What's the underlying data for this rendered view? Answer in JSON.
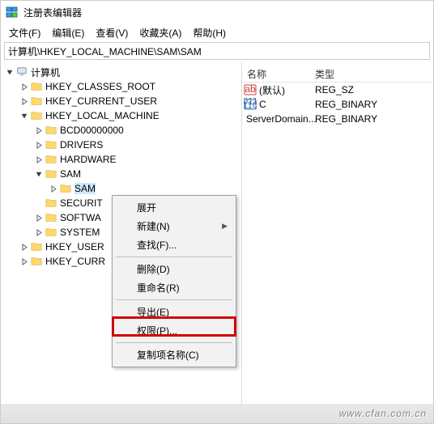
{
  "titlebar": {
    "title": "注册表编辑器"
  },
  "menubar": [
    {
      "label": "文件(F)"
    },
    {
      "label": "编辑(E)"
    },
    {
      "label": "查看(V)"
    },
    {
      "label": "收藏夹(A)"
    },
    {
      "label": "帮助(H)"
    }
  ],
  "addressbar": {
    "path": "计算机\\HKEY_LOCAL_MACHINE\\SAM\\SAM"
  },
  "tree": {
    "root": {
      "label": "计算机",
      "expand": "open"
    },
    "hkcr": {
      "label": "HKEY_CLASSES_ROOT"
    },
    "hkcu": {
      "label": "HKEY_CURRENT_USER"
    },
    "hklm": {
      "label": "HKEY_LOCAL_MACHINE",
      "expand": "open"
    },
    "bcd": {
      "label": "BCD00000000"
    },
    "drivers": {
      "label": "DRIVERS"
    },
    "hardware": {
      "label": "HARDWARE"
    },
    "sam": {
      "label": "SAM",
      "expand": "open"
    },
    "sam2": {
      "label": "SAM",
      "selected": true
    },
    "security": {
      "label": "SECURIT"
    },
    "software": {
      "label": "SOFTWA"
    },
    "system": {
      "label": "SYSTEM"
    },
    "hku": {
      "label": "HKEY_USER"
    },
    "hkcc": {
      "label": "HKEY_CURR"
    }
  },
  "list": {
    "headers": {
      "name": "名称",
      "type": "类型"
    },
    "rows": [
      {
        "name": "(默认)",
        "type": "REG_SZ",
        "icon": "str"
      },
      {
        "name": "C",
        "type": "REG_BINARY",
        "icon": "bin"
      },
      {
        "name": "ServerDomain...",
        "type": "REG_BINARY",
        "icon": "bin"
      }
    ]
  },
  "ctx": {
    "expand": "展开",
    "new": "新建(N)",
    "find": "查找(F)...",
    "delete": "删除(D)",
    "rename": "重命名(R)",
    "export": "导出(E)",
    "perms": "权限(P)...",
    "copyname": "复制项名称(C)"
  },
  "footer": {
    "text": "www.cfan.com.cn"
  }
}
